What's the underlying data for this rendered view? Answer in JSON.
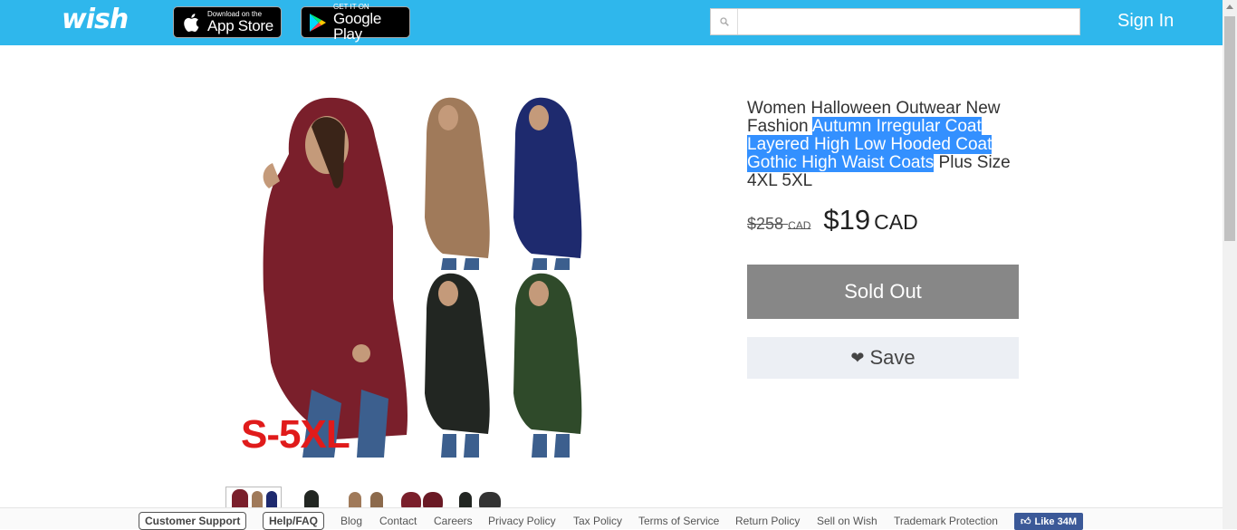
{
  "header": {
    "logo_text": "wish",
    "app_store": {
      "small": "Download on the",
      "big": "App Store"
    },
    "google_play": {
      "small": "GET IT ON",
      "big": "Google Play"
    },
    "search_value": "",
    "search_placeholder": "",
    "sign_in": "Sign In",
    "color": "#2fb7ec"
  },
  "product": {
    "image_overlay_text": "S-5XL",
    "title_pre": "Women Halloween Outwear New Fashion ",
    "title_highlight": "Autumn Irregular Coat Layered High Low Hooded Coat Gothic High Waist Coats",
    "title_post": " Plus Size 4XL 5XL",
    "old_price": "$258",
    "old_currency": "CAD",
    "price": "$19",
    "currency": "CAD",
    "sold_out_label": "Sold Out",
    "save_label": "Save",
    "coat_colors": [
      "#7a1f2b",
      "#a07a5a",
      "#1e2a6e",
      "#222622",
      "#2f4a2a"
    ],
    "thumbnails": [
      "thumb-1",
      "thumb-2",
      "thumb-3",
      "thumb-4",
      "thumb-5"
    ]
  },
  "footer": {
    "customer_support": "Customer Support",
    "help_faq": "Help/FAQ",
    "links": [
      "Blog",
      "Contact",
      "Careers",
      "Privacy Policy",
      "Tax Policy",
      "Terms of Service",
      "Return Policy",
      "Sell on Wish",
      "Trademark Protection"
    ],
    "fb_like": "Like 34M"
  }
}
